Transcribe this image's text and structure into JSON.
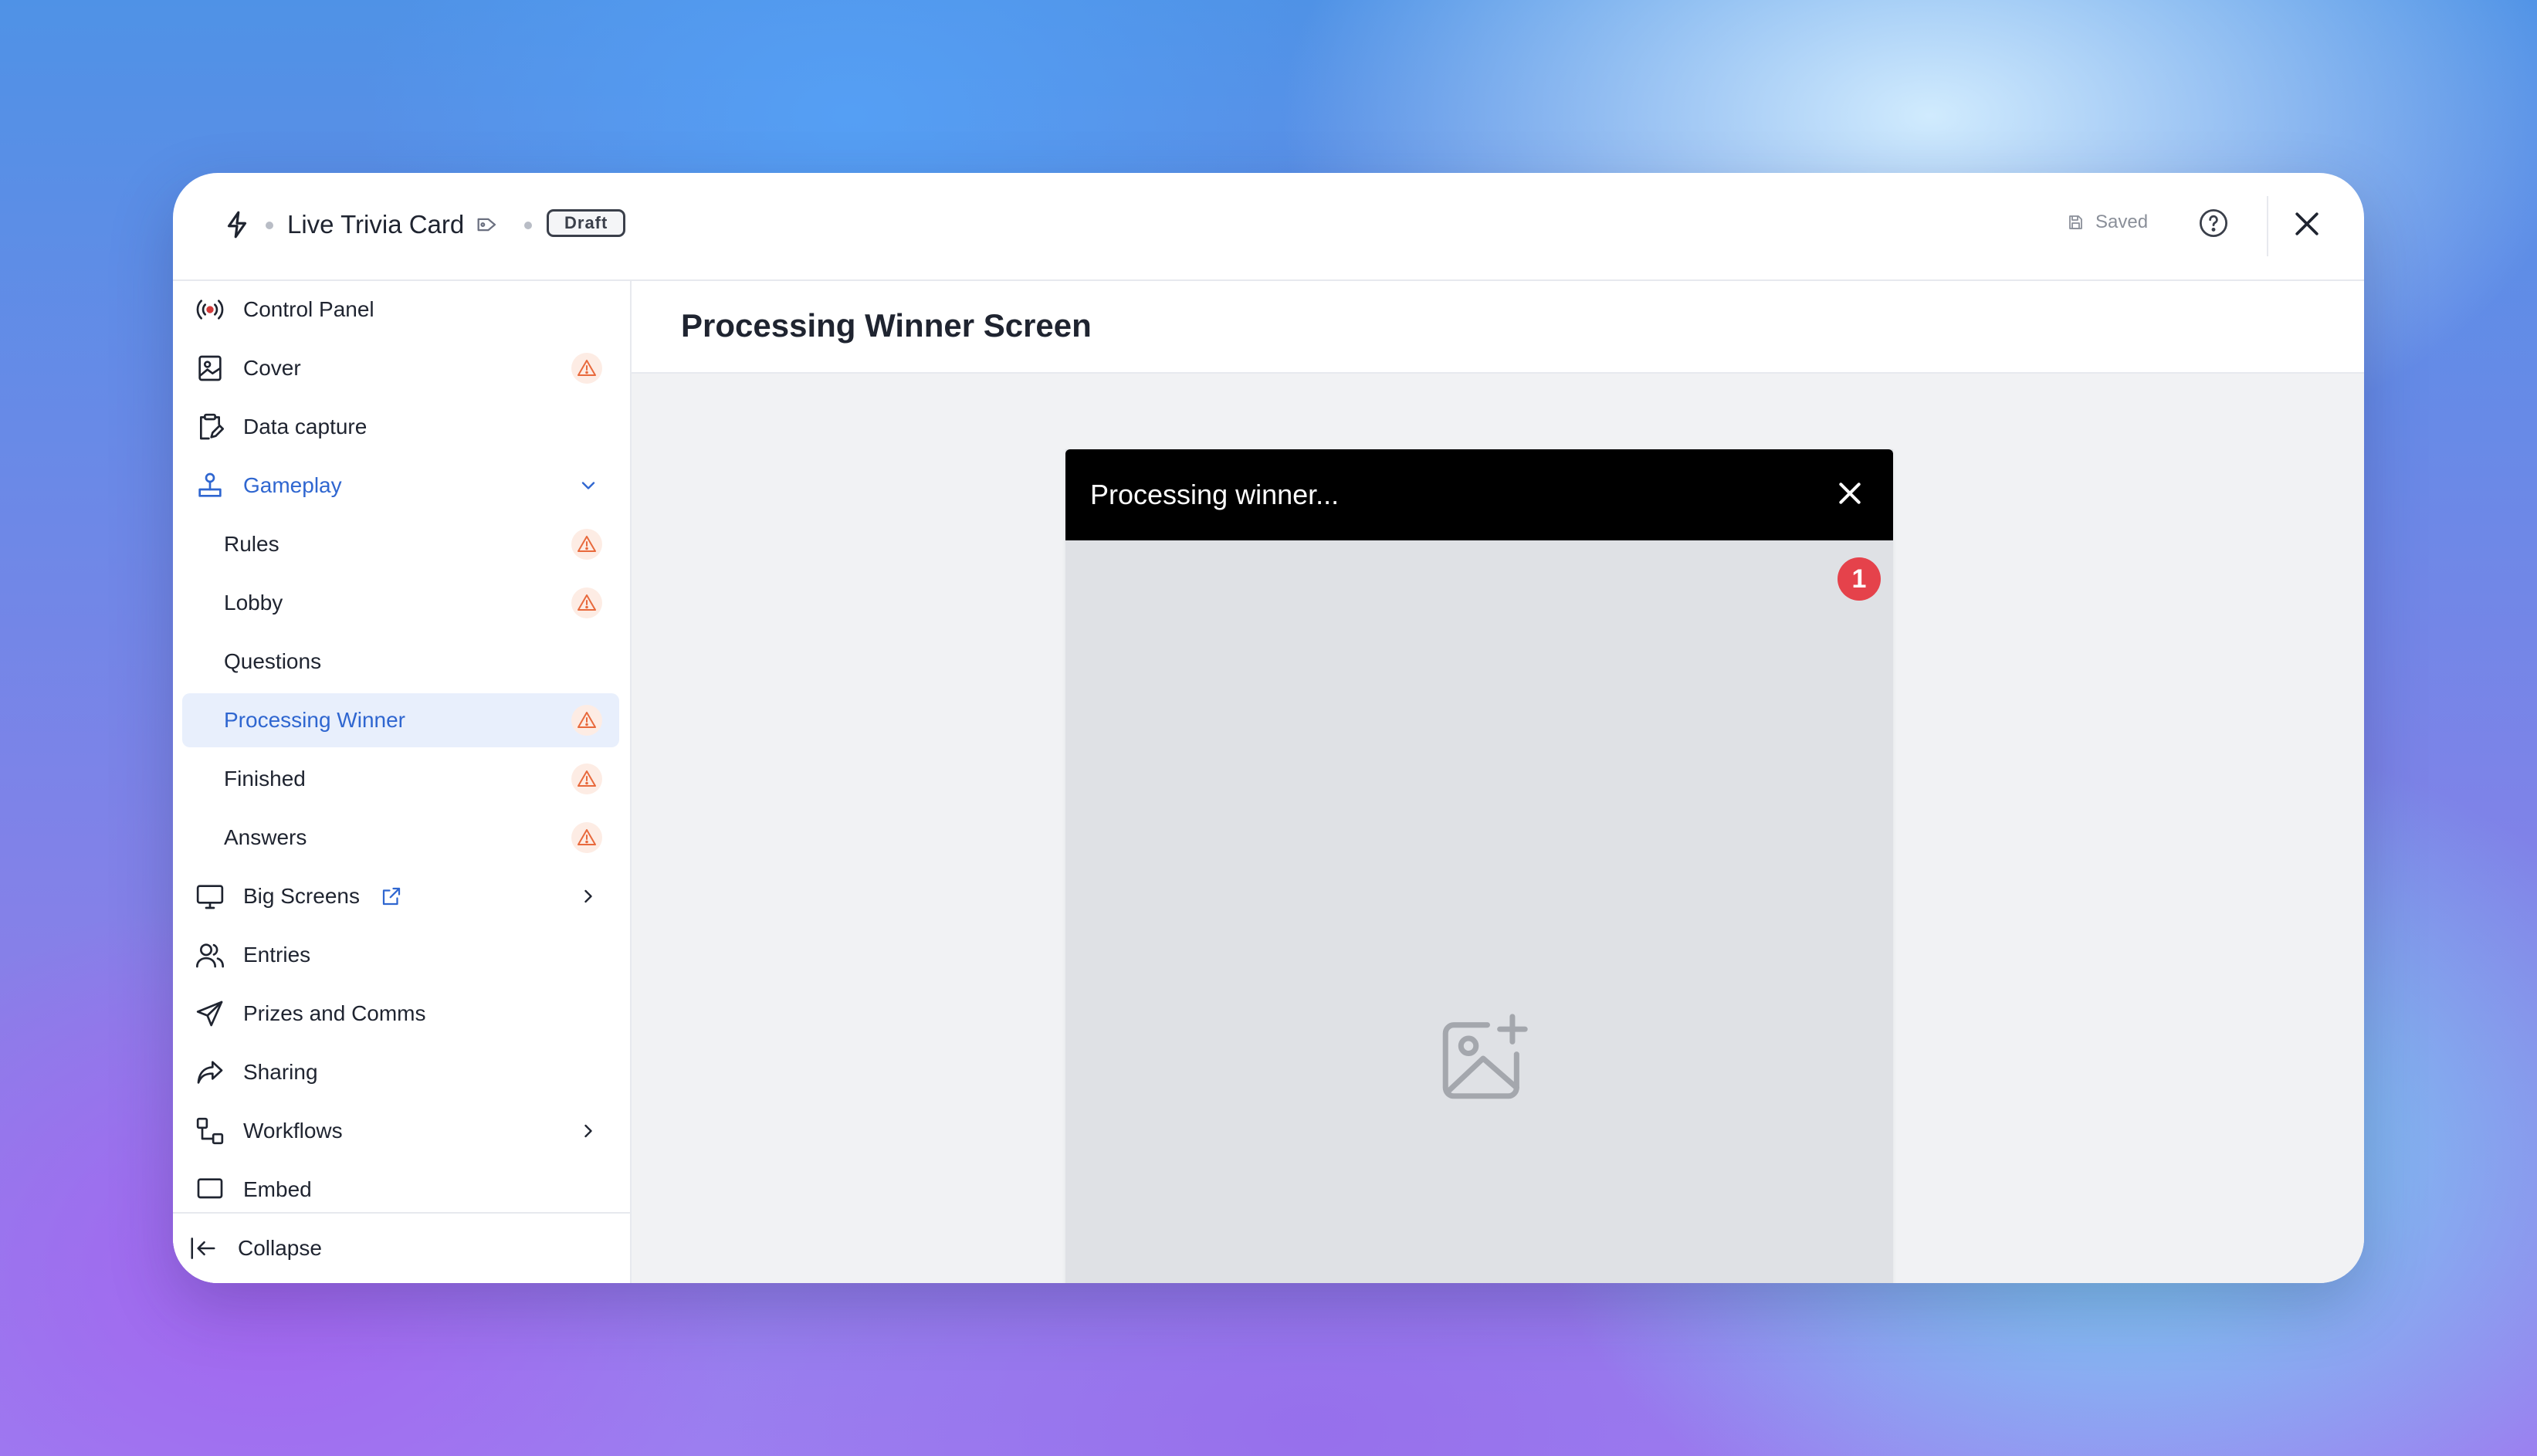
{
  "header": {
    "app_title": "Live Trivia Card",
    "status_badge": "Draft",
    "saved_label": "Saved",
    "icons": [
      "bolt-icon",
      "tag-icon",
      "save-icon",
      "help-icon",
      "close-icon"
    ]
  },
  "sidebar": {
    "items": [
      {
        "label": "Control Panel",
        "icon": "broadcast-icon",
        "warning": false
      },
      {
        "label": "Cover",
        "icon": "image-file-icon",
        "warning": true
      },
      {
        "label": "Data capture",
        "icon": "clipboard-icon",
        "warning": false
      },
      {
        "label": "Gameplay",
        "icon": "joystick-icon",
        "expanded": true
      },
      {
        "label": "Rules",
        "warning": true
      },
      {
        "label": "Lobby",
        "warning": true
      },
      {
        "label": "Questions",
        "warning": false
      },
      {
        "label": "Processing Winner",
        "warning": true,
        "active": true
      },
      {
        "label": "Finished",
        "warning": true
      },
      {
        "label": "Answers",
        "warning": true
      },
      {
        "label": "Big Screens",
        "icon": "monitor-icon",
        "external": true
      },
      {
        "label": "Entries",
        "icon": "users-icon"
      },
      {
        "label": "Prizes and Comms",
        "icon": "send-icon"
      },
      {
        "label": "Sharing",
        "icon": "share-icon"
      },
      {
        "label": "Workflows",
        "icon": "workflow-icon"
      },
      {
        "label": "Embed",
        "icon": "embed-icon"
      }
    ],
    "collapse_label": "Collapse"
  },
  "main": {
    "page_title": "Processing Winner Screen",
    "preview": {
      "title": "Processing winner...",
      "badge_count": "1",
      "placeholder_icon": "image-add-icon"
    }
  },
  "colors": {
    "accent": "#2f66d0",
    "active_bg": "#e8effc",
    "warning": "#e8693c",
    "warning_bg": "#fdece4",
    "badge": "#e5424b",
    "preview_header": "#000000",
    "preview_body": "#dfe1e5",
    "canvas_bg": "#f1f2f4"
  }
}
